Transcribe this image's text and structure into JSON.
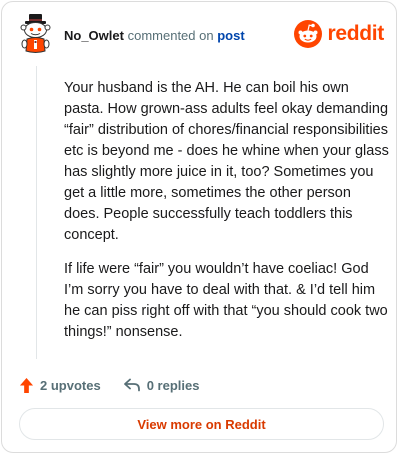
{
  "header": {
    "username": "No_Owlet",
    "commented_text": "commented on",
    "post_link": "post",
    "brand_name": "reddit",
    "avatar_icon": "snoo-top-hat-avatar-icon",
    "brand_icon": "reddit-snoo-logo-icon"
  },
  "comment": {
    "paragraphs": [
      "Your husband is the AH. He can boil his own pasta. How grown-ass adults feel okay demanding “fair” distribution of chores/financial responsibilities etc is beyond me - does he whine when your glass has slightly more juice in it, too? Sometimes you get a little more, sometimes the other person does. People successfully teach toddlers this concept.",
      "If life were “fair” you wouldn’t have coeliac! God I’m sorry you have to deal with that. & I’d tell him he can piss right off with that “you should cook two things!” nonsense."
    ]
  },
  "actions": {
    "upvotes_label": "2 upvotes",
    "replies_label": "0 replies",
    "upvote_icon": "upvote-arrow-icon",
    "reply_icon": "reply-arrow-icon"
  },
  "footer": {
    "view_more_label": "View more on Reddit"
  },
  "colors": {
    "brand": "#ff4500",
    "link": "#0045ac",
    "muted": "#576f76",
    "button_text": "#d93a00"
  }
}
